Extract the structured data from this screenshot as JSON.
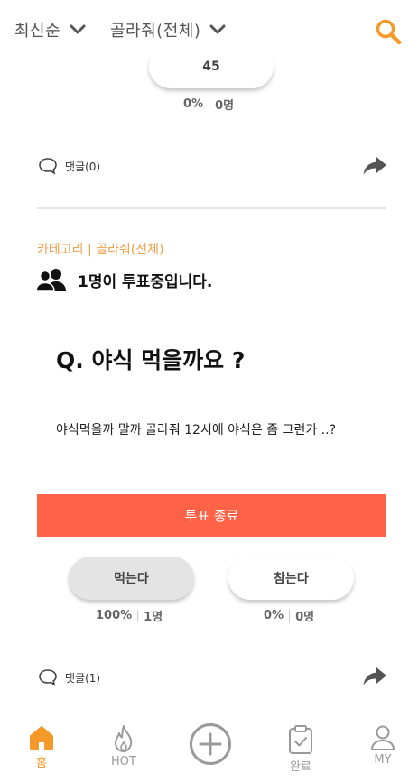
{
  "header": {
    "sort_label": "최신순",
    "category_label": "골라줘(전체)"
  },
  "prev_post": {
    "vote_count_label": "45",
    "percent": "0%",
    "count": "0명",
    "comment_label": "댓글(0)"
  },
  "post": {
    "category_line": "카테고리 | 골라줘(전체)",
    "voters_text": "1명이 투표중입니다.",
    "question": "Q. 야식 먹을까요 ?",
    "description": "야식먹을까 말까 골라줘 12시에 야식은 좀 그런가 ..?",
    "end_label": "투표 종료",
    "options": [
      {
        "label": "먹는다",
        "percent": "100%",
        "count": "1명",
        "selected": true
      },
      {
        "label": "참는다",
        "percent": "0%",
        "count": "0명",
        "selected": false
      }
    ],
    "comment_label": "댓글(1)"
  },
  "nav": {
    "home": "홈",
    "hot": "HOT",
    "done": "완료",
    "my": "MY"
  },
  "colors": {
    "accent": "#f39a2a",
    "end_bar": "#ff6347",
    "category": "#f0a04b"
  }
}
